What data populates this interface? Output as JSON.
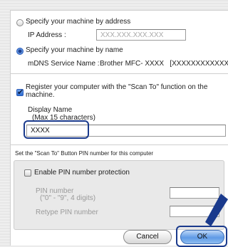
{
  "address_option": {
    "label": "Specify your machine by address",
    "ip_label": "IP Address :",
    "ip_placeholder": "XXX.XXX.XXX.XXX"
  },
  "name_option": {
    "label": "Specify your machine by name",
    "mdns_label": "mDNS Service Name :",
    "mdns_value": "Brother MFC- XXXX   [XXXXXXXXXXXX]"
  },
  "register": {
    "label_line1": "Register your computer with the \"Scan To\" function on the",
    "label_line2": "machine.",
    "display_name_label": "Display Name",
    "display_name_hint": "(Max 15 characters)",
    "display_name_value": "XXXX"
  },
  "pin": {
    "section_title": "Set the \"Scan To\" Button PIN number for this computer",
    "enable_label": "Enable PIN number protection",
    "pin_label": "PIN number",
    "pin_hint": "(\"0\" - \"9\", 4 digits)",
    "retype_label": "Retype PIN number"
  },
  "buttons": {
    "cancel": "Cancel",
    "ok": "OK"
  },
  "colors": {
    "callout": "#1a3a8c",
    "accent": "#3d78d8"
  }
}
